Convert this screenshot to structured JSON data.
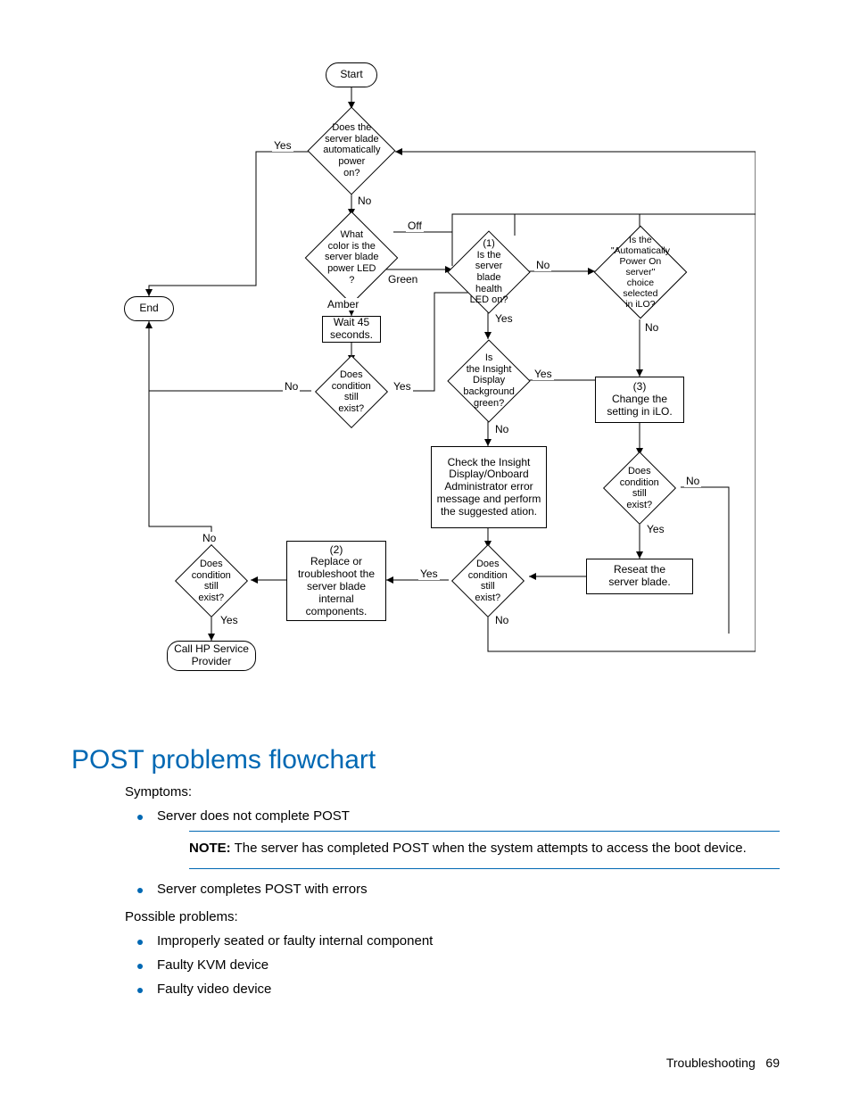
{
  "chart_data": {
    "type": "flowchart",
    "title": "Server blade power-on troubleshooting",
    "nodes": [
      {
        "id": "start",
        "type": "terminal",
        "text": "Start"
      },
      {
        "id": "d1",
        "type": "decision",
        "text": "Does the server blade automatically power on?",
        "edges": {
          "Yes": "end",
          "No": "d2"
        }
      },
      {
        "id": "d2",
        "type": "decision",
        "text": "What color is the server blade power LED ?",
        "edges": {
          "Off": "d4",
          "Green": "d3",
          "Amber": "p1"
        }
      },
      {
        "id": "p1",
        "type": "process",
        "text": "Wait 45 seconds."
      },
      {
        "id": "d5",
        "type": "decision",
        "text": "Does condition still exist?",
        "edges": {
          "Yes": "d3",
          "No": "end"
        }
      },
      {
        "id": "d3",
        "type": "decision",
        "text": "(1) Is the server blade health LED on?",
        "edges": {
          "Yes": "d6",
          "No": "d4"
        }
      },
      {
        "id": "d6",
        "type": "decision",
        "text": "Is the Insight Display background green?",
        "edges": {
          "Yes": "p3",
          "No": "p2"
        }
      },
      {
        "id": "p2",
        "type": "process",
        "text": "Check the Insight Display/Onboard Administrator error message and perform the suggested ation."
      },
      {
        "id": "d7",
        "type": "decision",
        "text": "Does condition still exist?",
        "edges": {
          "Yes": "p4",
          "No": "d3"
        }
      },
      {
        "id": "p4",
        "type": "process",
        "text": "(2) Replace or troubleshoot the server blade internal components."
      },
      {
        "id": "d8",
        "type": "decision",
        "text": "Does condition still exist?",
        "edges": {
          "Yes": "p6",
          "No": "end"
        }
      },
      {
        "id": "p6",
        "type": "terminal",
        "text": "Call HP Service Provider"
      },
      {
        "id": "d4",
        "type": "decision",
        "text": "Is the \"Automatically Power On server\" choice selected in iLO?",
        "edges": {
          "Yes": "d3",
          "No": "p3"
        }
      },
      {
        "id": "p3",
        "type": "process",
        "text": "(3) Change the setting in iLO."
      },
      {
        "id": "d9",
        "type": "decision",
        "text": "Does condition still exist?",
        "edges": {
          "Yes": "p5",
          "No": "end"
        }
      },
      {
        "id": "p5",
        "type": "process",
        "text": "Reseat the server blade."
      },
      {
        "id": "end",
        "type": "terminal",
        "text": "End"
      }
    ]
  },
  "flow": {
    "start": "Start",
    "end": "End",
    "d1": "Does the\nserver blade\nautomatically\npower\non?",
    "d2": "What\ncolor is the\nserver blade\npower LED\n?",
    "p1": "Wait 45\nseconds.",
    "d5": "Does\ncondition still\nexist?",
    "d3": "(1)\nIs the server\nblade health\nLED on?",
    "d6": "Is\nthe Insight\nDisplay\nbackground\ngreen?",
    "p2": "Check the Insight\nDisplay/Onboard\nAdministrator error\nmessage and perform\nthe suggested ation.",
    "d7": "Does\ncondition still\nexist?",
    "p4": "(2)\nReplace or\ntroubleshoot the\nserver blade\ninternal\ncomponents.",
    "d8": "Does\ncondition still\nexist?",
    "p6": "Call HP Service\nProvider",
    "d4": "Is the\n\"Automatically\nPower On server\"\nchoice selected\nin iLO?",
    "p3": "(3)\nChange the\nsetting in iLO.",
    "d9": "Does\ncondition still\nexist?",
    "p5": "Reseat the\nserver blade.",
    "lbl_yes": "Yes",
    "lbl_no": "No",
    "lbl_off": "Off",
    "lbl_green": "Green",
    "lbl_amber": "Amber"
  },
  "section_title": "POST problems flowchart",
  "symptoms_label": "Symptoms:",
  "symptoms": [
    "Server does not complete POST",
    "Server completes POST with errors"
  ],
  "note_label": "NOTE:",
  "note_text": "  The server has completed POST when the system attempts to access the boot device.",
  "possible_label": "Possible problems:",
  "problems": [
    "Improperly seated or faulty internal component",
    "Faulty KVM device",
    "Faulty video device"
  ],
  "footer_section": "Troubleshooting",
  "footer_page": "69"
}
